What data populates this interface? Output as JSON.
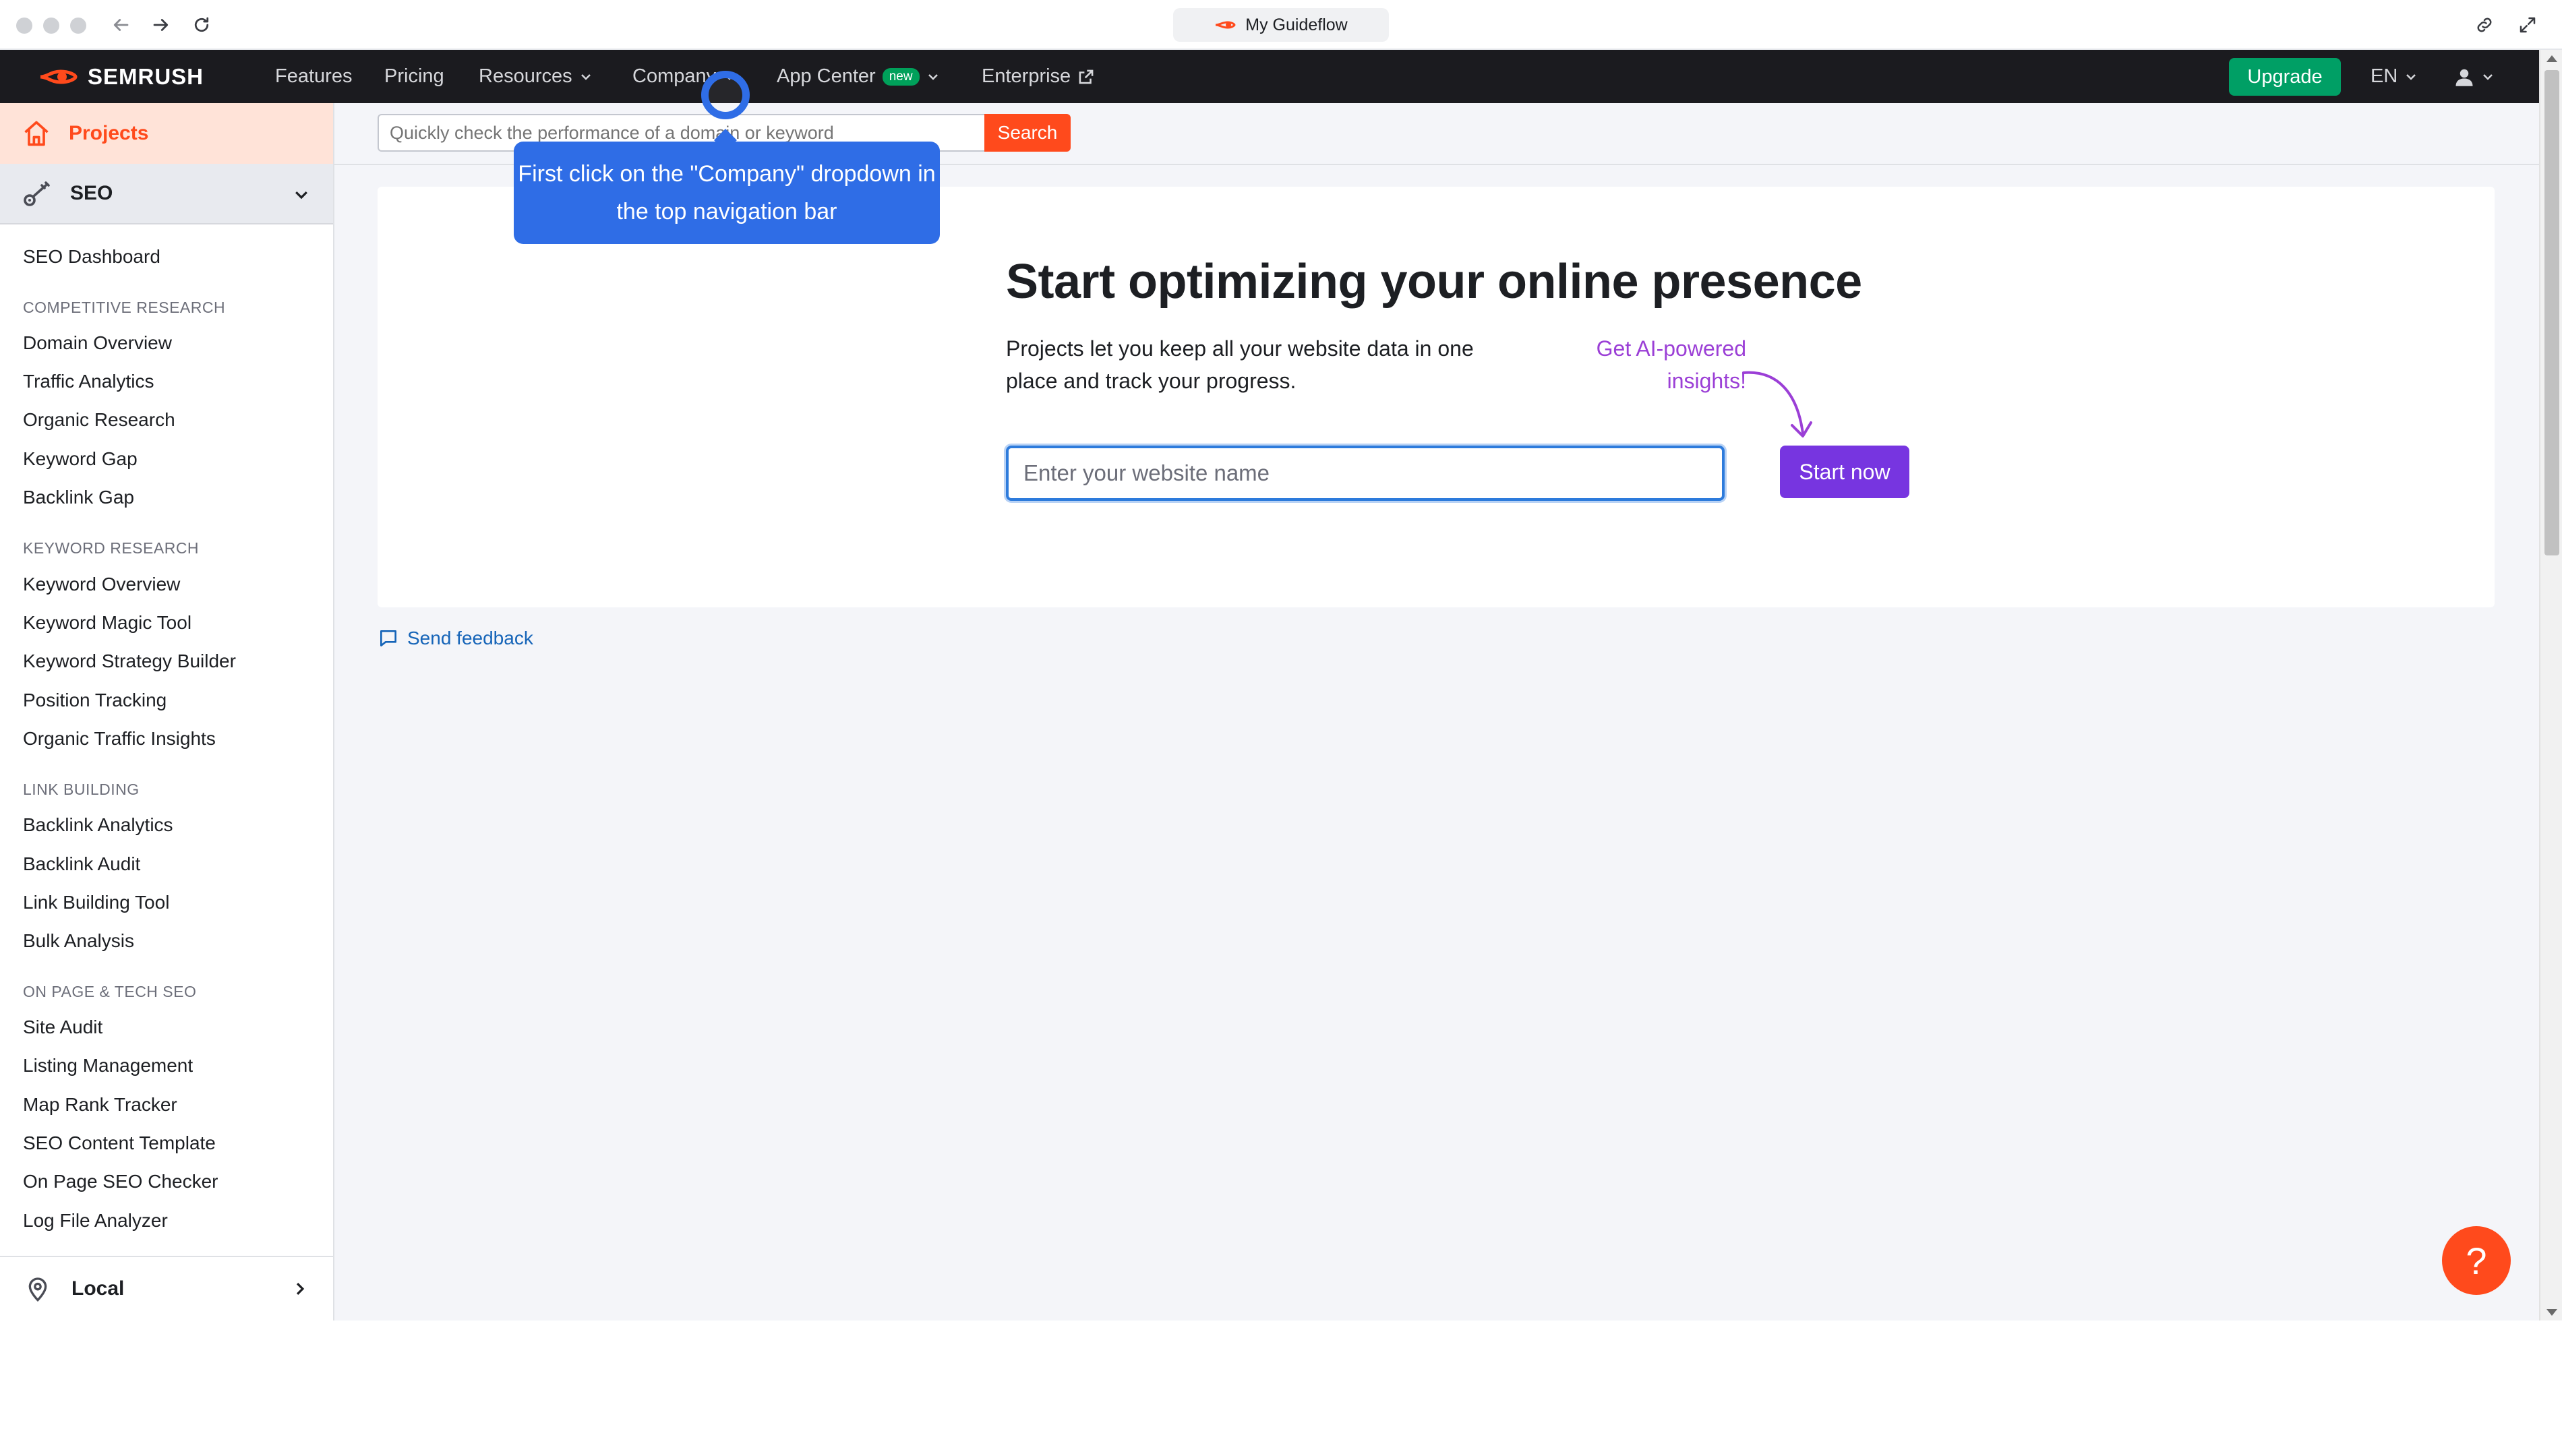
{
  "browser": {
    "tab_title": "My Guideflow"
  },
  "nav": {
    "brand": "SEMRUSH",
    "items": [
      {
        "label": "Features"
      },
      {
        "label": "Pricing"
      },
      {
        "label": "Resources"
      },
      {
        "label": "Company"
      },
      {
        "label": "App Center",
        "badge": "new"
      },
      {
        "label": "Enterprise"
      }
    ],
    "upgrade": "Upgrade",
    "language": "EN"
  },
  "sidebar": {
    "projects": "Projects",
    "seo": "SEO",
    "dashboard": "SEO Dashboard",
    "sections": [
      {
        "title": "COMPETITIVE RESEARCH",
        "items": [
          "Domain Overview",
          "Traffic Analytics",
          "Organic Research",
          "Keyword Gap",
          "Backlink Gap"
        ]
      },
      {
        "title": "KEYWORD RESEARCH",
        "items": [
          "Keyword Overview",
          "Keyword Magic Tool",
          "Keyword Strategy Builder",
          "Position Tracking",
          "Organic Traffic Insights"
        ]
      },
      {
        "title": "LINK BUILDING",
        "items": [
          "Backlink Analytics",
          "Backlink Audit",
          "Link Building Tool",
          "Bulk Analysis"
        ]
      },
      {
        "title": "ON PAGE & TECH SEO",
        "items": [
          "Site Audit",
          "Listing Management",
          "Map Rank Tracker",
          "SEO Content Template",
          "On Page SEO Checker",
          "Log File Analyzer"
        ]
      }
    ],
    "local": "Local"
  },
  "search": {
    "placeholder": "Quickly check the performance of a domain or keyword",
    "button": "Search"
  },
  "hero": {
    "title": "Start optimizing your online presence",
    "description": "Projects let you keep all your website data in one place and track your progress.",
    "ai_note": "Get AI-powered insights!",
    "input_placeholder": "Enter your website name",
    "cta": "Start now"
  },
  "feedback": "Send feedback",
  "help": "?",
  "guide": {
    "tooltip": "First click on the \"Company\" dropdown in the top navigation bar"
  },
  "colors": {
    "brand_orange": "#ff4a1c",
    "upgrade_green": "#009f65",
    "cta_purple": "#7735e0",
    "ai_purple": "#9b3fd6",
    "guide_blue": "#2f6de6",
    "link_blue": "#1564b8"
  }
}
